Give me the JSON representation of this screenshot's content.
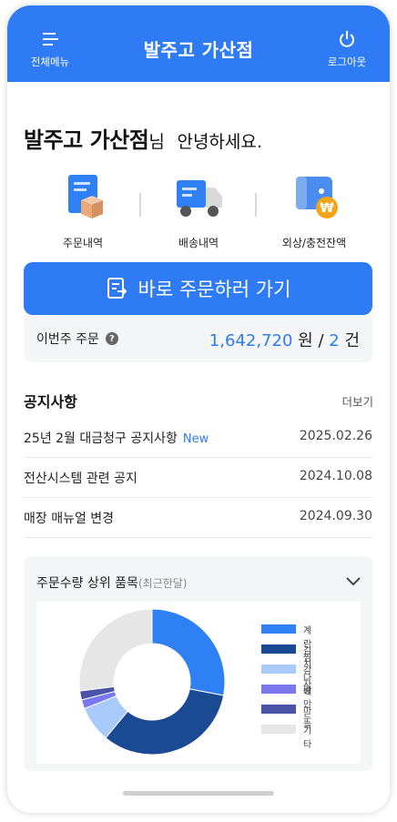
{
  "header": {
    "menu_label": "전체메뉴",
    "title": "발주고 가산점",
    "logout_label": "로그아웃",
    "color": "#2f7bf5"
  },
  "greeting": {
    "store": "발주고 가산점",
    "suffix": "님",
    "message": "안녕하세요."
  },
  "quick_menu": [
    {
      "label": "주문내역",
      "icon": "order-history-icon"
    },
    {
      "label": "배송내역",
      "icon": "delivery-truck-icon"
    },
    {
      "label": "외상/충전잔액",
      "icon": "wallet-won-icon"
    }
  ],
  "order_button": {
    "label": "바로 주문하러 가기"
  },
  "weekly_order": {
    "label": "이번주 주문",
    "amount": "1,642,720",
    "amount_unit": "원",
    "separator": "/",
    "count": "2",
    "count_unit": "건"
  },
  "notice": {
    "title": "공지사항",
    "more_label": "더보기",
    "items": [
      {
        "title": "25년 2월 대금청구 공지사항",
        "badge": "New",
        "date": "2025.02.26"
      },
      {
        "title": "전산시스템 관련 공지",
        "badge": "",
        "date": "2024.10.08"
      },
      {
        "title": "매장 매뉴얼 변경",
        "badge": "",
        "date": "2024.09.30"
      }
    ]
  },
  "top_items": {
    "title": "주문수량 상위 품목",
    "subtitle": "(최근한달)"
  },
  "chart_data": {
    "type": "pie",
    "donut": true,
    "title": "",
    "categories": [
      "계란찜",
      "김치나베",
      "감자",
      "왕만두",
      "마늘",
      "기타"
    ],
    "values": [
      28,
      33,
      8,
      2,
      2,
      27
    ],
    "colors": [
      "#2f80f5",
      "#1b4a95",
      "#a9cbfb",
      "#7b78ef",
      "#4a53a8",
      "#e6e6e6"
    ],
    "legend_position": "right"
  }
}
